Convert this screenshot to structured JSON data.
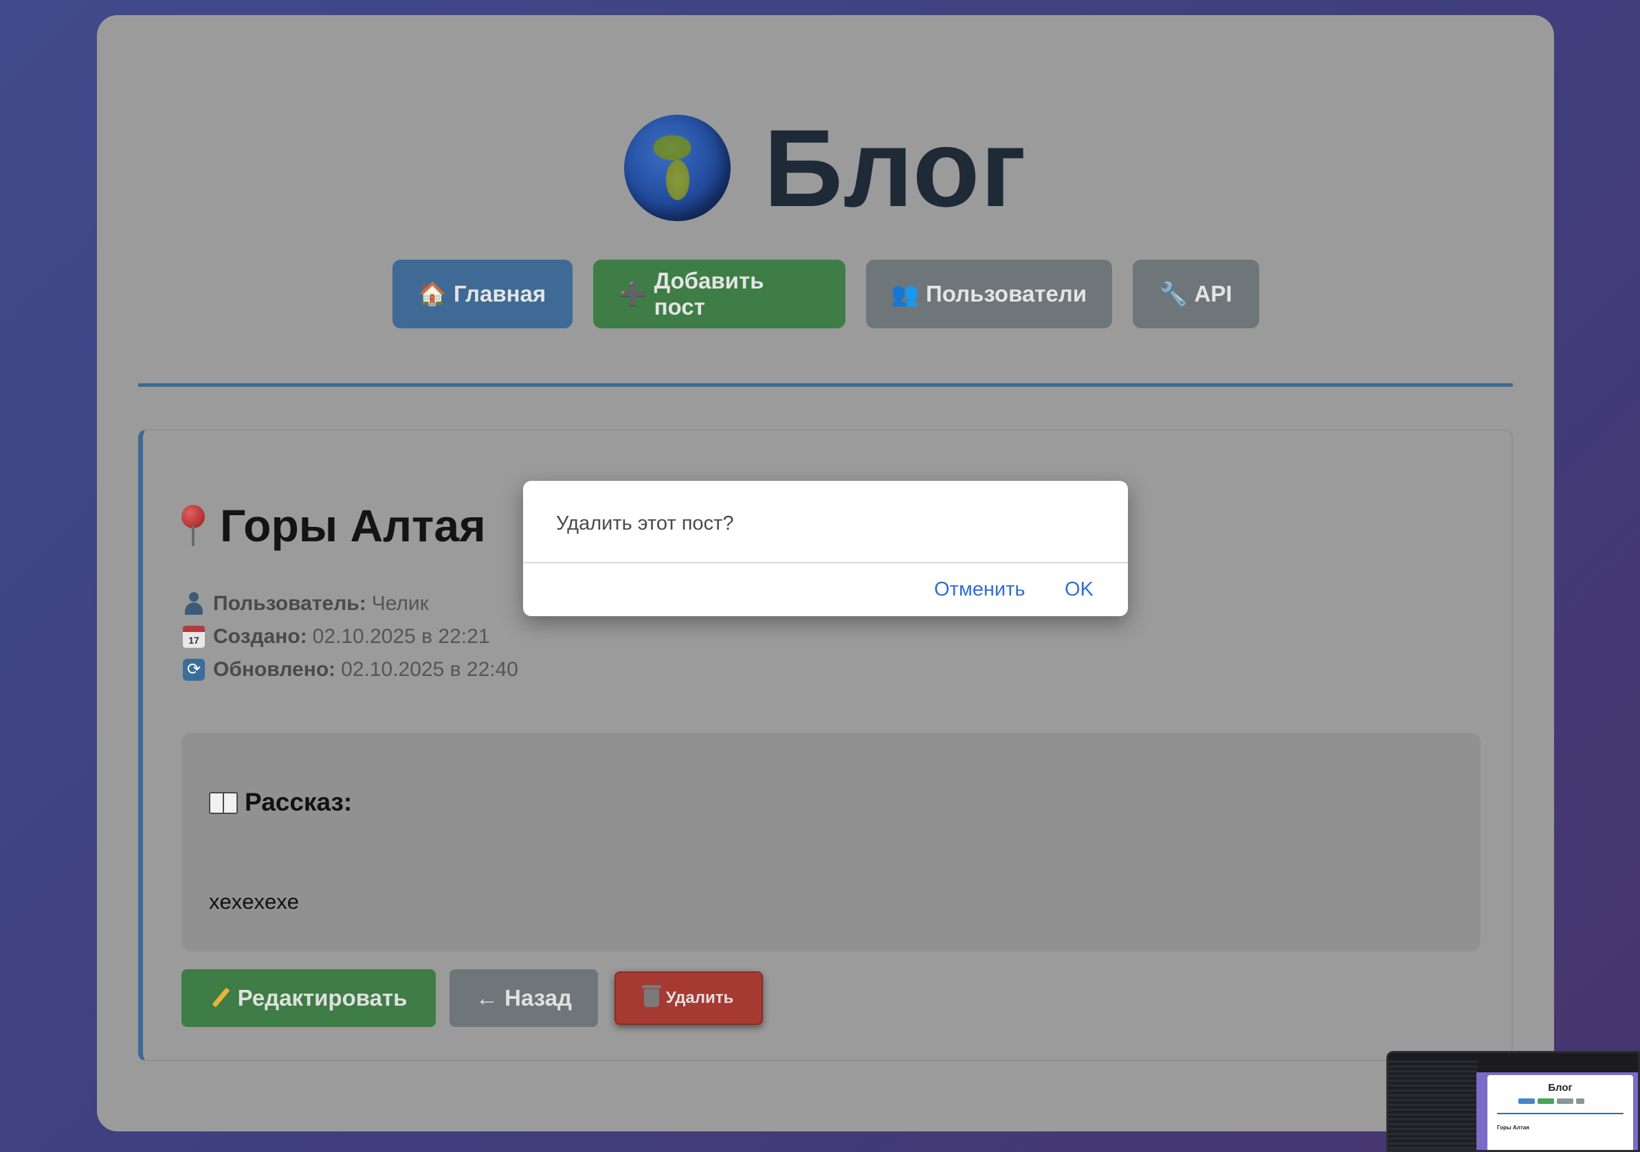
{
  "header": {
    "globe_icon": "globe-icon",
    "title": "Блог"
  },
  "nav": {
    "home": {
      "icon": "🏠",
      "label": "Главная"
    },
    "add_post": {
      "icon": "➕",
      "label": "Добавить пост"
    },
    "users": {
      "icon": "👥",
      "label": "Пользователи"
    },
    "api": {
      "icon": "🔧",
      "label": "API"
    }
  },
  "post": {
    "title": "Горы Алтая",
    "meta": {
      "user_label": "Пользователь:",
      "user_value": "Челик",
      "created_label": "Создано:",
      "created_value": "02.10.2025 в 22:21",
      "calendar_day": "17",
      "updated_label": "Обновлено:",
      "updated_value": "02.10.2025 в 22:40"
    },
    "story_heading": "Рассказ:",
    "story_text": "xexexexe"
  },
  "actions": {
    "edit": "Редактировать",
    "back": "← Назад",
    "delete": "Удалить"
  },
  "dialog": {
    "message": "Удалить этот пост?",
    "cancel": "Отменить",
    "ok": "OK"
  },
  "thumbnail": {
    "title": "Блог",
    "post_title": "Горы Алтая"
  },
  "colors": {
    "primary": "#3e6a95",
    "success": "#3e7d45",
    "secondary": "#6f767a",
    "danger": "#a63a33",
    "dialog_link": "#2f6fd6"
  }
}
